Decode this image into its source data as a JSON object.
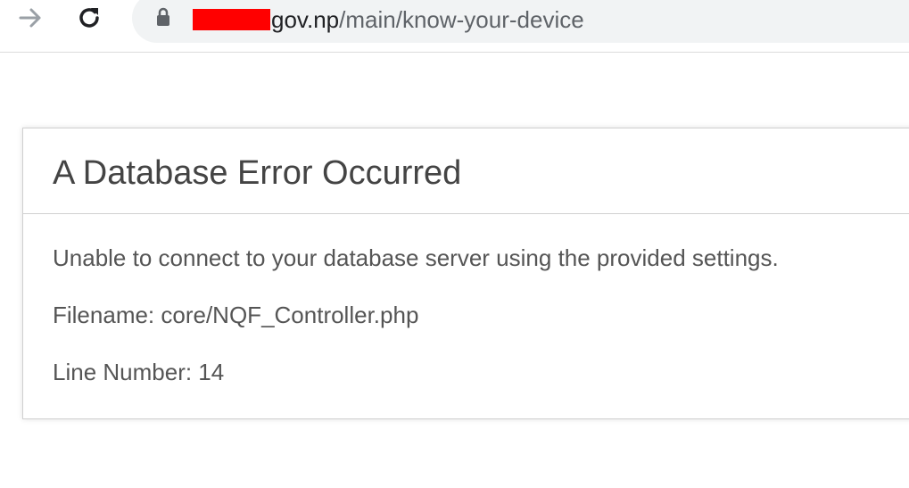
{
  "browser": {
    "url_domain": "gov.np",
    "url_path": "/main/know-your-device",
    "redaction_color": "#ff0000",
    "icons": {
      "back": "arrow-right-icon",
      "reload": "reload-icon",
      "lock": "lock-icon"
    }
  },
  "error": {
    "title": "A Database Error Occurred",
    "message": "Unable to connect to your database server using the provided settings.",
    "filename": "Filename: core/NQF_Controller.php",
    "line_number": "Line Number: 14"
  }
}
